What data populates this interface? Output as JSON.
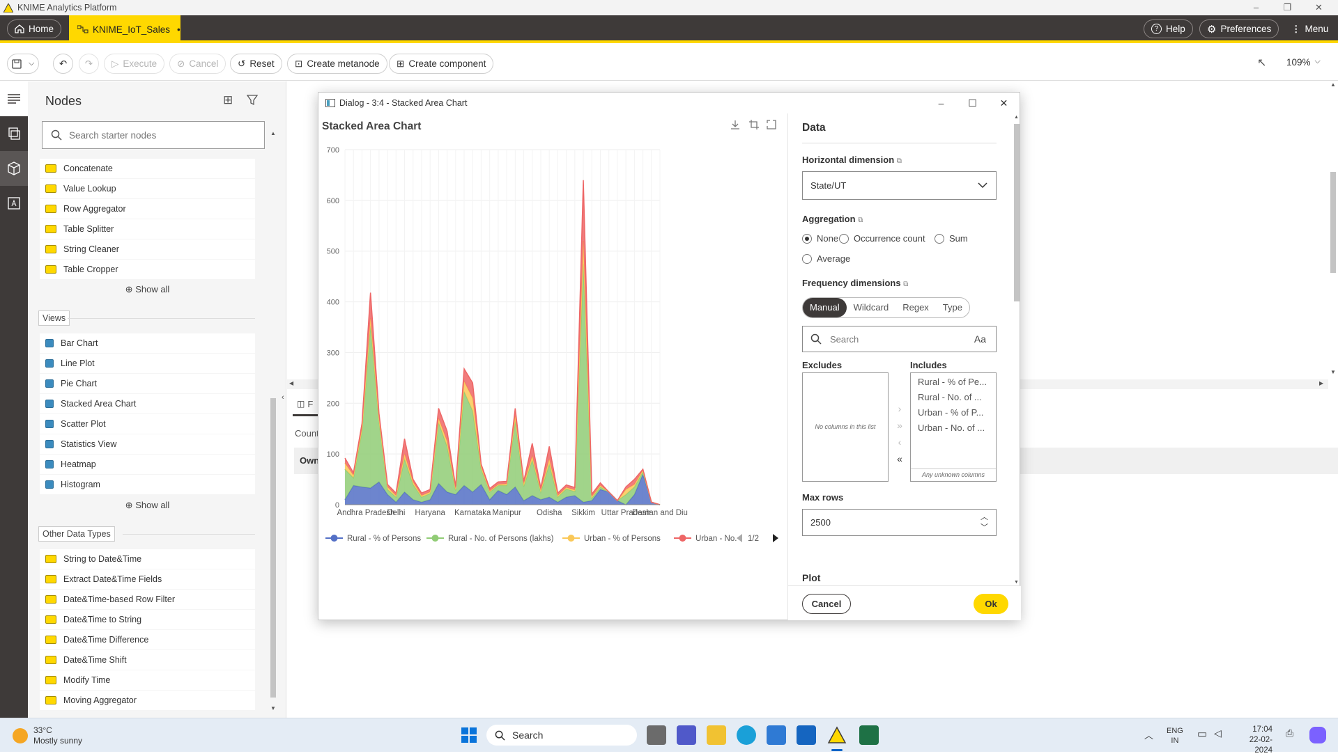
{
  "window": {
    "title": "KNIME Analytics Platform",
    "controls": [
      "–",
      "❐",
      "✕"
    ]
  },
  "appbar": {
    "home_label": "Home",
    "tab_label": "KNIME_IoT_Sales",
    "tab_dirty": "•",
    "help_label": "Help",
    "preferences_label": "Preferences",
    "menu_label": "Menu"
  },
  "toolbar": {
    "execute": "Execute",
    "cancel": "Cancel",
    "reset": "Reset",
    "create_metanode": "Create metanode",
    "create_component": "Create component",
    "zoom": "109%"
  },
  "nodes_panel": {
    "title": "Nodes",
    "search_placeholder": "Search starter nodes",
    "group1": [
      "Concatenate",
      "Value Lookup",
      "Row Aggregator",
      "Table Splitter",
      "String Cleaner",
      "Table Cropper"
    ],
    "show_all": "Show all",
    "views_label": "Views",
    "views": [
      "Bar Chart",
      "Line Plot",
      "Pie Chart",
      "Stacked Area Chart",
      "Scatter Plot",
      "Statistics View",
      "Heatmap",
      "Histogram"
    ],
    "other_label": "Other Data Types",
    "other": [
      "String to Date&Time",
      "Extract Date&Time Fields",
      "Date&Time-based Row Filter",
      "Date&Time to String",
      "Date&Time Difference",
      "Date&Time Shift",
      "Modify Time",
      "Moving Aggregator"
    ]
  },
  "background": {
    "tab_initial": "F",
    "count_label": "Count",
    "own_label": "Own"
  },
  "dialog": {
    "title": "Dialog - 3:4 - Stacked Area Chart",
    "chart_title": "Stacked Area Chart",
    "legend_page": "1/2",
    "panel": {
      "data_heading": "Data",
      "horizontal_label": "Horizontal dimension",
      "horizontal_value": "State/UT",
      "aggregation_label": "Aggregation",
      "agg_options": [
        "None",
        "Occurrence count",
        "Sum",
        "Average"
      ],
      "agg_selected": "None",
      "frequency_label": "Frequency dimensions",
      "modes": [
        "Manual",
        "Wildcard",
        "Regex",
        "Type"
      ],
      "search_placeholder": "Search",
      "case_label": "Aa",
      "excludes_label": "Excludes",
      "includes_label": "Includes",
      "excludes_empty": "No columns in this list",
      "includes": [
        "Rural - % of Pe...",
        "Rural - No. of ...",
        "Urban - % of P...",
        "Urban - No. of ..."
      ],
      "unknown_columns": "Any unknown columns",
      "max_rows_label": "Max rows",
      "max_rows_value": "2500",
      "plot_heading": "Plot"
    },
    "cancel": "Cancel",
    "ok": "Ok"
  },
  "chart_data": {
    "type": "area",
    "title": "Stacked Area Chart",
    "ylim": [
      0,
      700
    ],
    "yticks": [
      0,
      100,
      200,
      300,
      400,
      500,
      600,
      700
    ],
    "xtick_labels": [
      "Andhra Pradesh",
      "Delhi",
      "Haryana",
      "Karnataka",
      "Manipur",
      "Odisha",
      "Sikkim",
      "Uttar Pradesh",
      "Daman and Diu"
    ],
    "x_count": 37,
    "xtick_index": [
      1,
      8,
      12,
      18,
      23,
      29,
      33,
      39,
      46
    ],
    "stacked": true,
    "series": [
      {
        "name": "Rural - % of Persons",
        "color": "#5470c6",
        "values": [
          10,
          38,
          35,
          33,
          45,
          20,
          5,
          25,
          10,
          5,
          10,
          42,
          25,
          20,
          38,
          25,
          40,
          10,
          28,
          20,
          35,
          8,
          18,
          10,
          15,
          5,
          15,
          18,
          5,
          8,
          30,
          25,
          8,
          0,
          20,
          60,
          5,
          0
        ]
      },
      {
        "name": "Rural - No. of Persons (lakhs)",
        "color": "#91cc75",
        "values": [
          60,
          15,
          110,
          320,
          120,
          10,
          10,
          65,
          30,
          10,
          12,
          120,
          90,
          8,
          185,
          160,
          30,
          15,
          10,
          18,
          130,
          28,
          70,
          15,
          65,
          10,
          16,
          8,
          470,
          5,
          5,
          0,
          0,
          20,
          15,
          5,
          0,
          0
        ]
      },
      {
        "name": "Urban - % of Persons",
        "color": "#fac858",
        "values": [
          12,
          5,
          5,
          15,
          5,
          5,
          3,
          10,
          5,
          3,
          3,
          8,
          10,
          3,
          20,
          25,
          5,
          2,
          2,
          3,
          10,
          5,
          8,
          3,
          10,
          3,
          3,
          3,
          45,
          3,
          3,
          0,
          0,
          10,
          5,
          3,
          0,
          0
        ]
      },
      {
        "name": "Urban - No.",
        "color": "#ee6666",
        "values": [
          10,
          5,
          10,
          50,
          10,
          5,
          5,
          30,
          5,
          5,
          5,
          20,
          20,
          5,
          25,
          30,
          5,
          5,
          5,
          5,
          15,
          5,
          25,
          5,
          25,
          5,
          5,
          5,
          120,
          5,
          5,
          0,
          0,
          5,
          10,
          2,
          0,
          0
        ]
      }
    ]
  },
  "taskbar": {
    "weather_temp": "33°C",
    "weather_desc": "Mostly sunny",
    "search_placeholder": "Search",
    "lang1": "ENG",
    "lang2": "IN",
    "time": "17:04",
    "date": "22-02-2024"
  }
}
